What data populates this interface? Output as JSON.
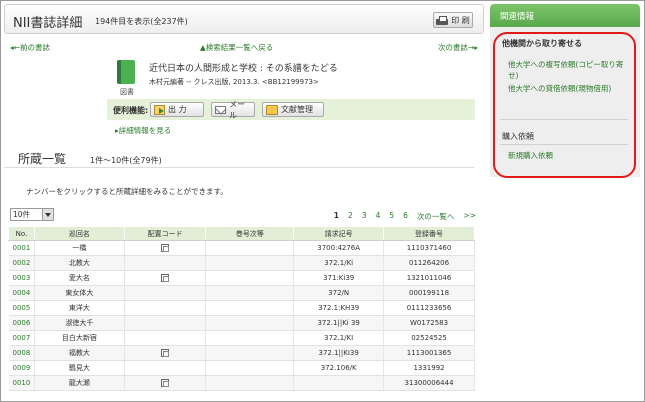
{
  "header": {
    "title": "NII書誌詳細",
    "count": "194件目を表示(全237件)",
    "print_label": "印 刷"
  },
  "nav": {
    "prev": "◂←前の書誌",
    "back": "▲検索結果一覧へ戻る",
    "next": "次の書誌→▸"
  },
  "book": {
    "type_label": "図書",
    "title": "近代日本の人間形成と学校 : その系譜をたどる",
    "author_line": "木村元編著 -- クレス出版, 2013.3. <BB12199973>"
  },
  "tools": {
    "label": "便利機能:",
    "output": "出 力",
    "mail": "メール",
    "doc": "文献管理"
  },
  "detail_link": "▸詳細情報を見る",
  "holdings": {
    "title": "所蔵一覧",
    "range": "1件〜10件(全79件)",
    "hint": "ナンバーをクリックすると所蔵詳細をみることができます。",
    "per_page": "10件",
    "pager": [
      "1",
      "2",
      "3",
      "4",
      "5",
      "6",
      "次の一覧へ",
      ">>"
    ],
    "columns": [
      "No.",
      "巡回名",
      "配置コード",
      "巻号次等",
      "請求記号",
      "登録番号"
    ],
    "rows": [
      {
        "no": "0001",
        "loc": "一橋",
        "code": true,
        "vol": "",
        "call": "3700:4276A",
        "reg": "1110371460"
      },
      {
        "no": "0002",
        "loc": "北教大",
        "code": false,
        "vol": "",
        "call": "372.1/Ki",
        "reg": "011264206"
      },
      {
        "no": "0003",
        "loc": "愛大名",
        "code": true,
        "vol": "",
        "call": "371:Ki39",
        "reg": "1321011046"
      },
      {
        "no": "0004",
        "loc": "東女体大",
        "code": false,
        "vol": "",
        "call": "372/N",
        "reg": "000199118"
      },
      {
        "no": "0005",
        "loc": "東洋大",
        "code": false,
        "vol": "",
        "call": "372.1:KH39",
        "reg": "0111233656"
      },
      {
        "no": "0006",
        "loc": "淑徳大千",
        "code": false,
        "vol": "",
        "call": "372.1||Ki 39",
        "reg": "W0172583"
      },
      {
        "no": "0007",
        "loc": "目白大新宿",
        "code": false,
        "vol": "",
        "call": "372.1/KI",
        "reg": "02524525"
      },
      {
        "no": "0008",
        "loc": "福教大",
        "code": true,
        "vol": "",
        "call": "372.1||KI39",
        "reg": "1113001365"
      },
      {
        "no": "0009",
        "loc": "鶴見大",
        "code": false,
        "vol": "",
        "call": "372.106/K",
        "reg": "1331992"
      },
      {
        "no": "0010",
        "loc": "龍大瀬",
        "code": true,
        "vol": "",
        "call": "",
        "reg": "31300006444"
      }
    ]
  },
  "sidebar": {
    "header": "関連情報",
    "section1": "他機関から取り寄せる",
    "link1": "他大学への複写依頼(コピー取り寄せ)",
    "link2": "他大学への貸借依頼(現物借用)",
    "section2": "購入依頼",
    "link3": "新規購入依頼"
  },
  "colors": {
    "accent_green": "#5aa84b",
    "link_green": "#2a7a2a",
    "highlight_red": "#e01b1b"
  }
}
